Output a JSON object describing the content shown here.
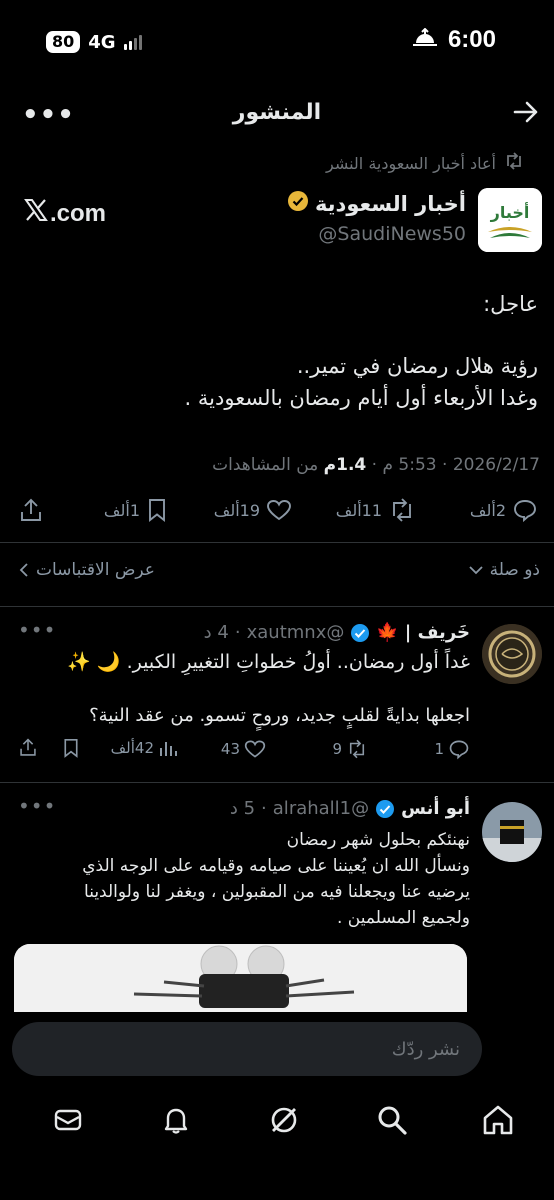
{
  "status_bar": {
    "battery": "80",
    "network": "4G",
    "time": "6:00"
  },
  "header": {
    "title": "المنشور"
  },
  "repost": {
    "label": "أعاد أخبار السعودية النشر"
  },
  "post": {
    "author_name": "أخبار السعودية",
    "author_handle": "@SaudiNews50",
    "avatar_text": "أخبار",
    "source_domain": ".com",
    "lines": [
      "عاجل:",
      "رؤية هلال رمضان في تمير..",
      "وغدا الأربعاء أول أيام رمضان بالسعودية ."
    ],
    "date": "2026/2/17",
    "time": "5:53 م",
    "views": "1.4م",
    "views_label": "من المشاهدات",
    "replies": "2ألف",
    "reposts": "11ألف",
    "likes": "19ألف",
    "bookmarks": "1ألف"
  },
  "sort": {
    "filter_label": "ذو صلة",
    "quotes_label": "عرض الاقتباسات"
  },
  "replies": [
    {
      "name": "خَريف |",
      "emoji": "🍁",
      "handle": "@xautmnx",
      "age": "4 د",
      "line1": "غداً أول رمضان.. أولُ خطواتِ التغييرِ الكبير. 🌙 ✨",
      "line2": "اجعلها بدايةً لقلبٍ جديد، وروحٍ تسمو. من عقد النية؟",
      "replies": "1",
      "reposts": "9",
      "likes": "43",
      "views": "42ألف"
    },
    {
      "name": "أبو أنس",
      "handle": "@alrahall1",
      "age": "5 د",
      "lines": [
        "نهنئكم بحلول شهر رمضان",
        "ونسأل الله ان يُعيننا على صيامه وقيامه على الوجه الذي",
        "يرضيه عنا ويجعلنا فيه من المقبولين ، ويغفر لنا ولوالدينا",
        "ولجميع المسلمين ."
      ]
    }
  ],
  "composer": {
    "placeholder": "نشر ردّك"
  },
  "colors": {
    "background": "#000000",
    "text": "#e7e9ea",
    "muted": "#71767b",
    "verified": "#1d9bf0",
    "gold": "#e8b73a"
  }
}
